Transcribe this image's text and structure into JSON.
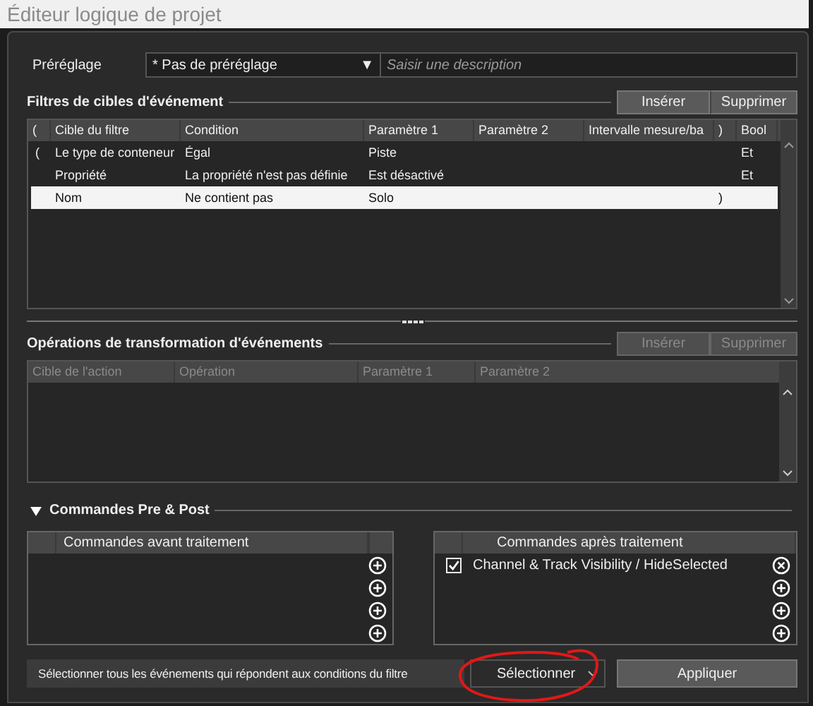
{
  "window": {
    "title": "Éditeur logique de projet"
  },
  "preset": {
    "label": "Préréglage",
    "value": "* Pas de préréglage",
    "arrow": "▼",
    "placeholder": "Saisir une description"
  },
  "filters": {
    "title": "Filtres de cibles d'événement",
    "buttons": [
      {
        "label": "Insérer",
        "disabled": false
      },
      {
        "label": "Supprimer",
        "disabled": false
      }
    ],
    "columns": [
      {
        "label": "("
      },
      {
        "label": "Cible du filtre"
      },
      {
        "label": "Condition"
      },
      {
        "label": "Paramètre 1"
      },
      {
        "label": "Paramètre 2"
      },
      {
        "label": "Intervalle mesure/ba"
      },
      {
        "label": ")"
      },
      {
        "label": "Bool"
      }
    ],
    "rows": [
      {
        "cells": [
          "(",
          "Le type de conteneur",
          "Égal",
          "Piste",
          null,
          null,
          null,
          "Et"
        ],
        "selected": false
      },
      {
        "cells": [
          null,
          "Propriété",
          "La propriété n'est pas définie",
          "Est désactivé",
          null,
          null,
          null,
          "Et"
        ],
        "selected": false
      },
      {
        "cells": [
          null,
          "Nom",
          "Ne contient pas",
          "Solo",
          null,
          null,
          ")",
          null
        ],
        "selected": true
      }
    ]
  },
  "operations": {
    "title": "Opérations de transformation d'événements",
    "buttons": [
      {
        "label": "Insérer",
        "disabled": true
      },
      {
        "label": "Supprimer",
        "disabled": true
      }
    ],
    "columns": [
      {
        "label": "Cible de l'action",
        "disabled": true
      },
      {
        "label": "Opération",
        "disabled": true
      },
      {
        "label": "Paramètre 1",
        "disabled": true
      },
      {
        "label": "Paramètre 2",
        "disabled": true
      }
    ]
  },
  "commands": {
    "title": "Commandes Pre & Post",
    "expanded": true,
    "panels": [
      {
        "header": "Commandes avant traitement",
        "slots": [
          {
            "kind": "empty"
          },
          {
            "kind": "empty"
          },
          {
            "kind": "empty"
          },
          {
            "kind": "empty"
          }
        ]
      },
      {
        "header": "Commandes après traitement",
        "slots": [
          {
            "kind": "command",
            "label": "Channel & Track Visibility / HideSelected",
            "checked": true
          },
          {
            "kind": "empty"
          },
          {
            "kind": "empty"
          },
          {
            "kind": "empty"
          }
        ]
      }
    ]
  },
  "bottom_bar": {
    "description": "Sélectionner tous les événements qui répondent aux conditions du filtre",
    "mode": "Sélectionner",
    "apply": "Appliquer"
  }
}
